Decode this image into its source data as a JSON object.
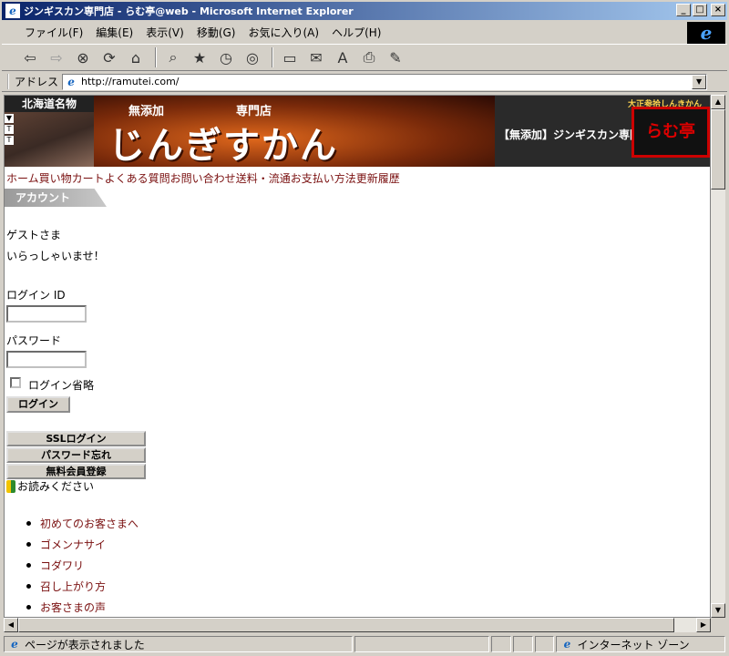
{
  "window": {
    "title": "ジンギスカン専門店 - らむ亭@web - Microsoft Internet Explorer",
    "controls": [
      "_",
      "□",
      "×"
    ]
  },
  "menubar": {
    "items": [
      "ファイル(F)",
      "編集(E)",
      "表示(V)",
      "移動(G)",
      "お気に入り(A)",
      "ヘルプ(H)"
    ]
  },
  "toolbar": {
    "buttons": [
      "back-icon",
      "forward-icon",
      "stop-icon",
      "refresh-icon",
      "home-icon",
      "search-icon",
      "favorites-icon",
      "history-icon",
      "channels-icon",
      "fullscreen-icon",
      "mail-icon",
      "font-icon",
      "print-icon",
      "edit-icon"
    ]
  },
  "address": {
    "label": "アドレス",
    "url": "http://ramutei.com/"
  },
  "banner": {
    "hokkaido": "北海道名物",
    "tabs": [
      "▼",
      "T",
      "T"
    ],
    "sub1": "無添加",
    "sub2": "専門店",
    "big": "じんぎすかん",
    "tagline": "【無添加】ジンギスカン専門店 らむ亭@",
    "logo_top": "大正参拾しんきかん",
    "logo": "らむ亭"
  },
  "nav": {
    "items": [
      "ホーム",
      "買い物カート",
      "よくある質問",
      "お問い合わせ",
      "送料・流通",
      "お支払い方法",
      "更新履歴"
    ]
  },
  "account": {
    "tab": "アカウント",
    "guest": "ゲストさま",
    "welcome": "いらっしゃいませ！",
    "login_id_label": "ログイン ID",
    "login_id_value": "",
    "password_label": "パスワード",
    "password_value": "",
    "remember_label": "ログイン省略",
    "login_button": "ログイン",
    "ssl_login": "SSLログイン",
    "forgot_password": "パスワード忘れ",
    "register": "無料会員登録"
  },
  "readme": {
    "title": "お読みください",
    "links": [
      "初めてのお客さまへ",
      "ゴメンナサイ",
      "コダワリ",
      "召し上がり方",
      "お客さまの声"
    ]
  },
  "status": {
    "text": "ページが表示されました",
    "zone": "インターネット ゾーン"
  }
}
